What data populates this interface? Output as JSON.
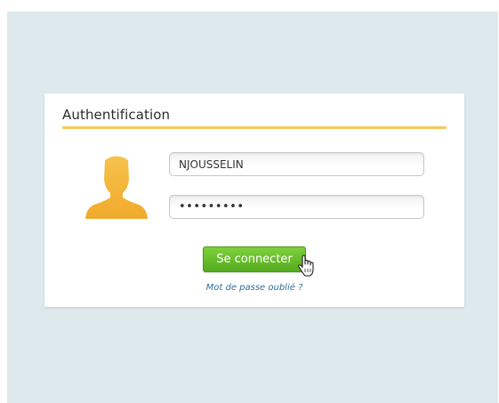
{
  "login": {
    "title": "Authentification",
    "username_value": "NJOUSSELIN",
    "password_value": "•••••••••",
    "submit_label": "Se connecter",
    "forgot_password_label": "Mot de passe oublié ?"
  },
  "icons": {
    "avatar": "user-silhouette-icon",
    "pointer": "hand-pointer-icon"
  },
  "colors": {
    "background": "#dde9ec",
    "accent_rule": "#f5c85c",
    "button": "#5cb224",
    "link": "#2d6e9a",
    "avatar": "#f4b63b"
  }
}
